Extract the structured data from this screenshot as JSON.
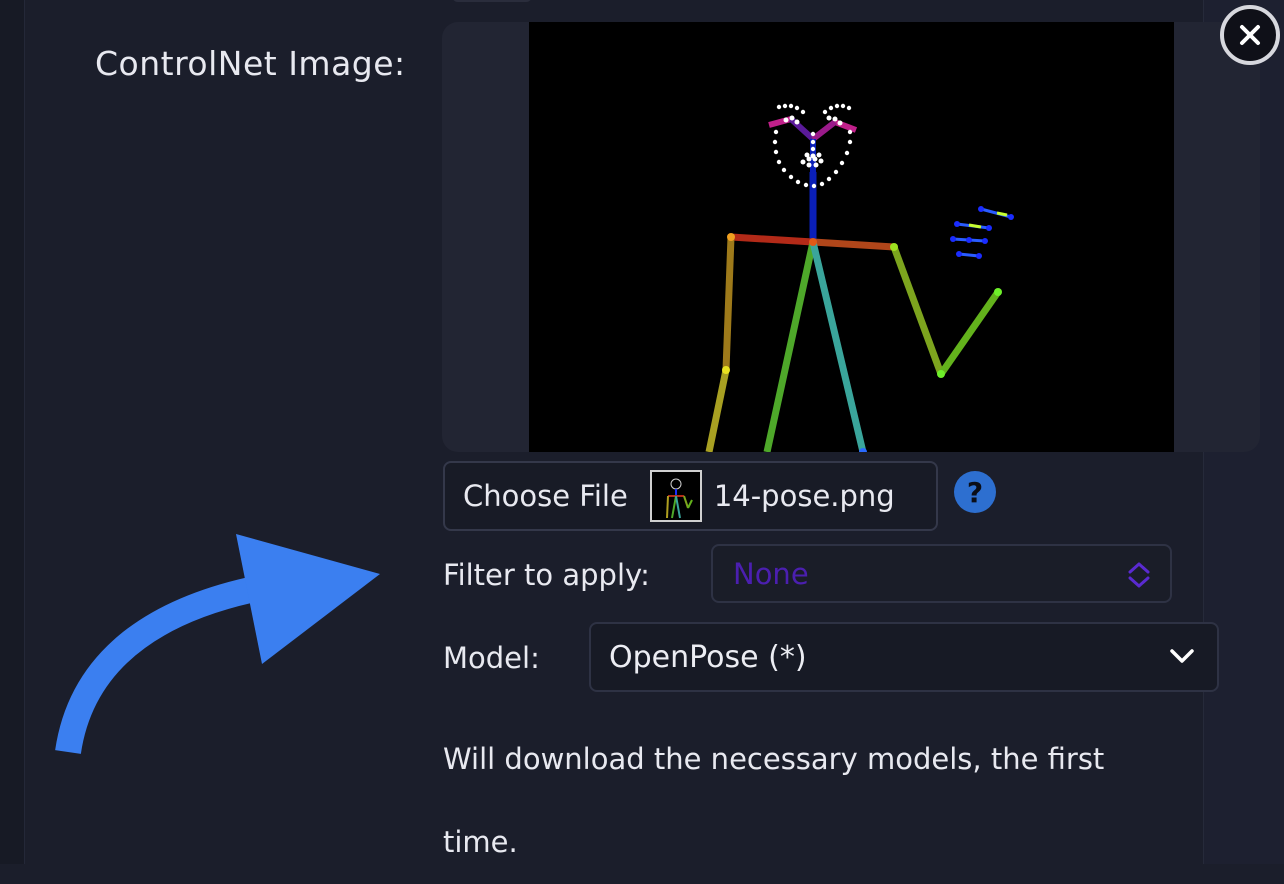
{
  "controlnet": {
    "label": "ControlNet Image:"
  },
  "file": {
    "choose_label": "Choose File",
    "file_name": "14-pose.png"
  },
  "help": {
    "glyph": "?"
  },
  "filter": {
    "label": "Filter to apply:",
    "value": "None"
  },
  "model": {
    "label": "Model:",
    "value": "OpenPose (*)"
  },
  "note": {
    "text": "Will download the necessary models, the first time."
  },
  "colors": {
    "background": "#1b1e2b",
    "accent_arrow": "#3b7ff0",
    "help_icon": "#2d6fd0",
    "filter_value_text": "#4b1fb0"
  },
  "icons": {
    "close": "close-icon",
    "help": "help-icon",
    "filter_toggle": "updown-chevron-icon",
    "model_toggle": "chevron-down-icon",
    "annotation": "curved-arrow-icon"
  }
}
